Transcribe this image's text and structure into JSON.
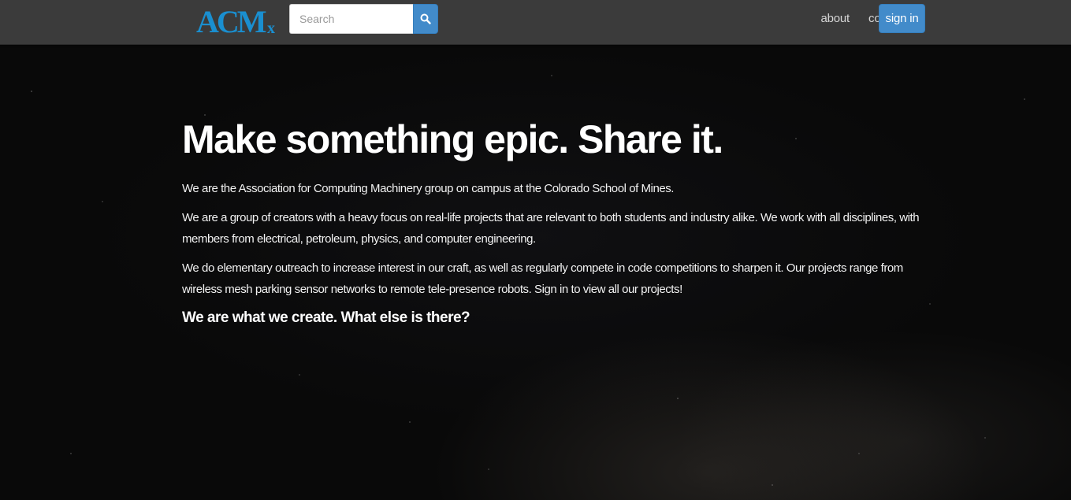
{
  "navbar": {
    "logo_text": "ACMx",
    "search": {
      "placeholder": "Search",
      "value": ""
    },
    "search_button_icon": "search-icon",
    "links": [
      {
        "label": "about"
      },
      {
        "label": "contact"
      }
    ],
    "signin_label": "sign in"
  },
  "hero": {
    "title": "Make something epic. Share it.",
    "paragraphs": [
      "We are the Association for Computing Machinery group on campus at the Colorado School of Mines.",
      "We are a group of creators with a heavy focus on real-life projects that are relevant to both students and industry alike. We work with all disciplines, with members from electrical, petroleum, physics, and computer engineering.",
      "We do elementary outreach to increase interest in our craft, as well as regularly compete in code competitions to sharpen it. Our projects range from wireless mesh parking sensor networks to remote tele-presence robots. Sign in to view all our projects!"
    ],
    "tagline": "We are what we create. What else is there?"
  },
  "colors": {
    "navbar_bg": "#3b3b3b",
    "accent": "#428bca",
    "logo": "#1a8fd0",
    "background": "#090909",
    "text": "#ffffff"
  }
}
